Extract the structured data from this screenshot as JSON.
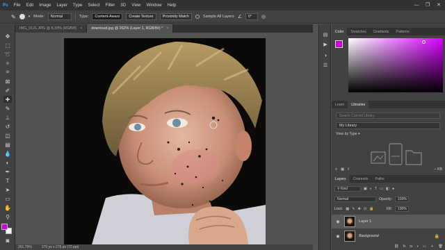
{
  "menu": [
    "File",
    "Edit",
    "Image",
    "Layer",
    "Type",
    "Select",
    "Filter",
    "3D",
    "View",
    "Window",
    "Help"
  ],
  "window_controls": {
    "minimize": "—",
    "restore": "❐",
    "close": "✕"
  },
  "options": {
    "mode_label": "Mode:",
    "mode_value": "Normal",
    "type_label": "Type:",
    "type_buttons": [
      "Content-Aware",
      "Create Texture",
      "Proximity Match"
    ],
    "sample_all_layers": "Sample All Layers",
    "angle_value": "0°"
  },
  "tabs": [
    {
      "label": "IMG_9121.JPG @ 8.33% (RGB/8)",
      "close": "×"
    },
    {
      "label": "download.jpg @ 262% (Layer 1, RGB/8#) *",
      "close": "×"
    }
  ],
  "status": {
    "zoom": "261.79%",
    "doc": "279 px x 275 px (72 ppi)"
  },
  "color_panel": {
    "tabs": [
      "Color",
      "Swatches",
      "Gradients",
      "Patterns"
    ],
    "foreground": "#c800d8",
    "background": "#ffffff"
  },
  "libraries_panel": {
    "tabs": [
      "Learn",
      "Libraries"
    ],
    "search_placeholder": "Search Current Library",
    "library": "My Library",
    "view_by": "View by Type",
    "size": "-- KB"
  },
  "layers_panel": {
    "tabs": [
      "Layers",
      "Channels",
      "Paths"
    ],
    "filter_kind": "Kind",
    "blend_mode": "Normal",
    "opacity_label": "Opacity:",
    "opacity_value": "100%",
    "lock_label": "Lock:",
    "fill_label": "Fill:",
    "fill_value": "100%",
    "layers": [
      {
        "name": "Layer 1",
        "selected": true
      },
      {
        "name": "Background",
        "selected": false
      }
    ]
  }
}
